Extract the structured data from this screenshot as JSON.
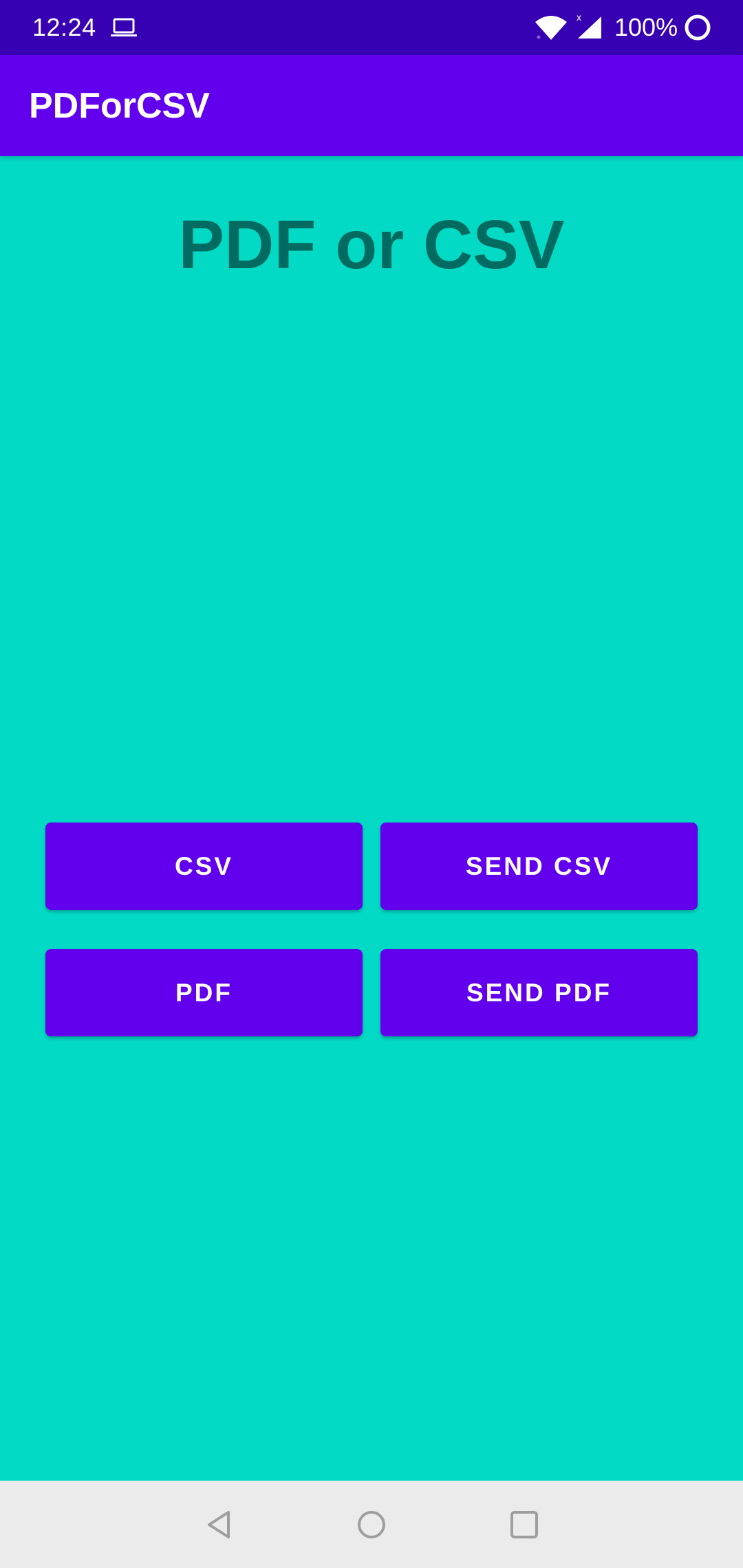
{
  "status_bar": {
    "time": "12:24",
    "battery_percent": "100%",
    "signal_indicator": "x",
    "icons": [
      "laptop-icon",
      "wifi-icon",
      "signal-icon",
      "battery-icon"
    ]
  },
  "app_bar": {
    "title": "PDForCSV"
  },
  "main": {
    "heading": "PDF or CSV"
  },
  "buttons": {
    "csv": "CSV",
    "send_csv": "SEND CSV",
    "pdf": "PDF",
    "send_pdf": "SEND PDF"
  },
  "nav_bar": {
    "icons": [
      "back-icon",
      "home-icon",
      "recents-icon"
    ]
  },
  "colors": {
    "status_bar": "#3700B3",
    "primary": "#6200EE",
    "background": "#03DAC5",
    "heading_text": "#006B60",
    "nav_bar": "#EBEBEB"
  }
}
